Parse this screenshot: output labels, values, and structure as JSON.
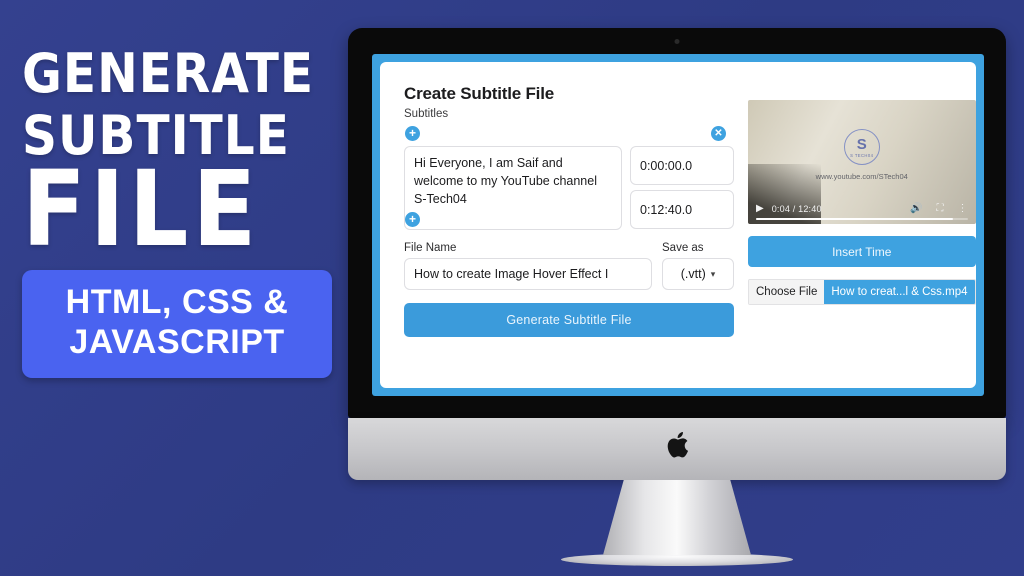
{
  "thumbnail": {
    "headline_line1": "GENERATE",
    "headline_line2": "SUBTITLE",
    "headline_line3": "FILE",
    "badge_line1": "HTML, CSS &",
    "badge_line2": "JAVASCRIPT",
    "background_color": "#2f3b88",
    "badge_color": "#4a63f0"
  },
  "app": {
    "title": "Create Subtitle File",
    "subtitles_label": "Subtitles",
    "accent_color": "#3ea2e0",
    "icons": {
      "add_top": "+",
      "add_bottom": "+",
      "remove": "✕"
    },
    "subtitle_entry": {
      "text": "Hi Everyone, I am Saif and welcome to my YouTube channel S-Tech04",
      "start_time": "0:00:00.0",
      "end_time": "0:12:40.0"
    },
    "file_name": {
      "label": "File Name",
      "value": "How to create Image Hover Effect I"
    },
    "save_as": {
      "label": "Save as",
      "value": "(.vtt)",
      "chevron": "⌄"
    },
    "generate_button": "Generate Subtitle File",
    "insert_time_button": "Insert Time",
    "file_picker": {
      "choose_label": "Choose File",
      "file_name": "How to creat...l & Css.mp4"
    },
    "video": {
      "logo_letter": "S",
      "logo_subtext": "S TECH04",
      "watermark_url": "www.youtube.com/STech04",
      "play_icon": "▶",
      "time_display": "0:04 / 12:40",
      "volume_icon": "🔊",
      "fullscreen_icon": "⛶",
      "menu_icon": "⋮",
      "progress_percent": 93
    }
  },
  "device": {
    "brand_logo": ""
  }
}
